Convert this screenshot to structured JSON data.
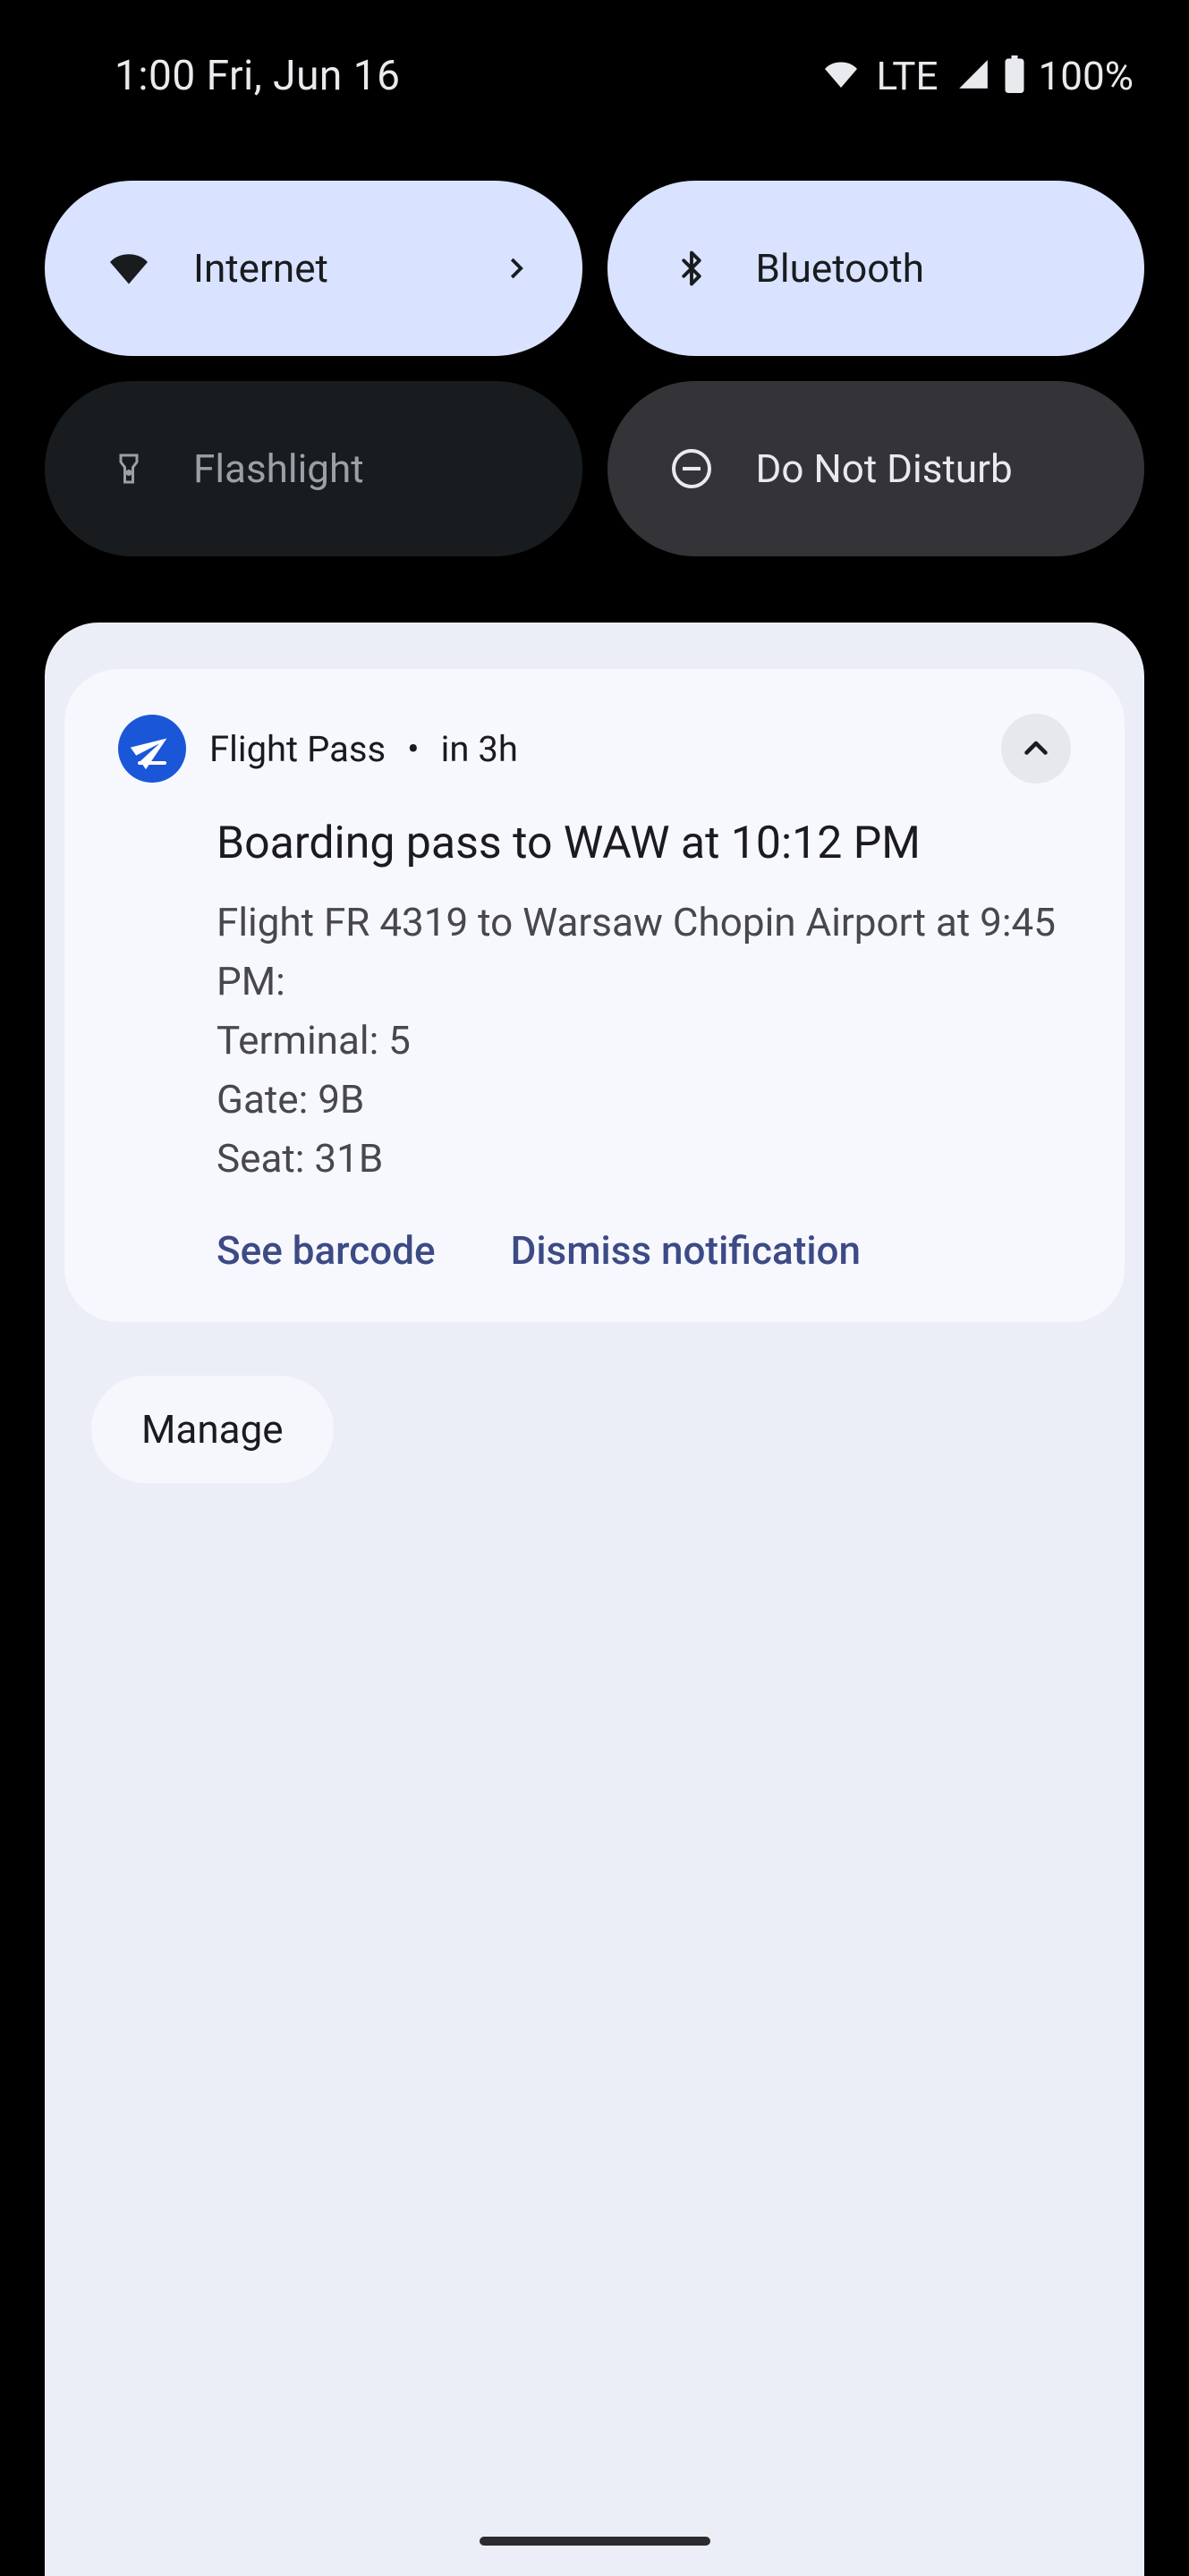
{
  "statusbar": {
    "time": "1:00 Fri, Jun 16",
    "network_type": "LTE",
    "battery_text": "100%"
  },
  "quick_settings": {
    "internet": {
      "label": "Internet",
      "state": "active"
    },
    "bluetooth": {
      "label": "Bluetooth",
      "state": "active"
    },
    "flashlight": {
      "label": "Flashlight",
      "state": "inactive"
    },
    "dnd": {
      "label": "Do Not Disturb",
      "state": "inactive"
    }
  },
  "notification": {
    "app_name": "Flight Pass",
    "separator": "•",
    "when": "in 3h",
    "title": "Boarding pass to WAW at 10:12 PM",
    "body": "Flight FR 4319 to Warsaw Chopin Airport at 9:45 PM:\nTerminal: 5\nGate: 9B\nSeat: 31B",
    "actions": {
      "primary": "See barcode",
      "secondary": "Dismiss notification"
    }
  },
  "manage_label": "Manage"
}
